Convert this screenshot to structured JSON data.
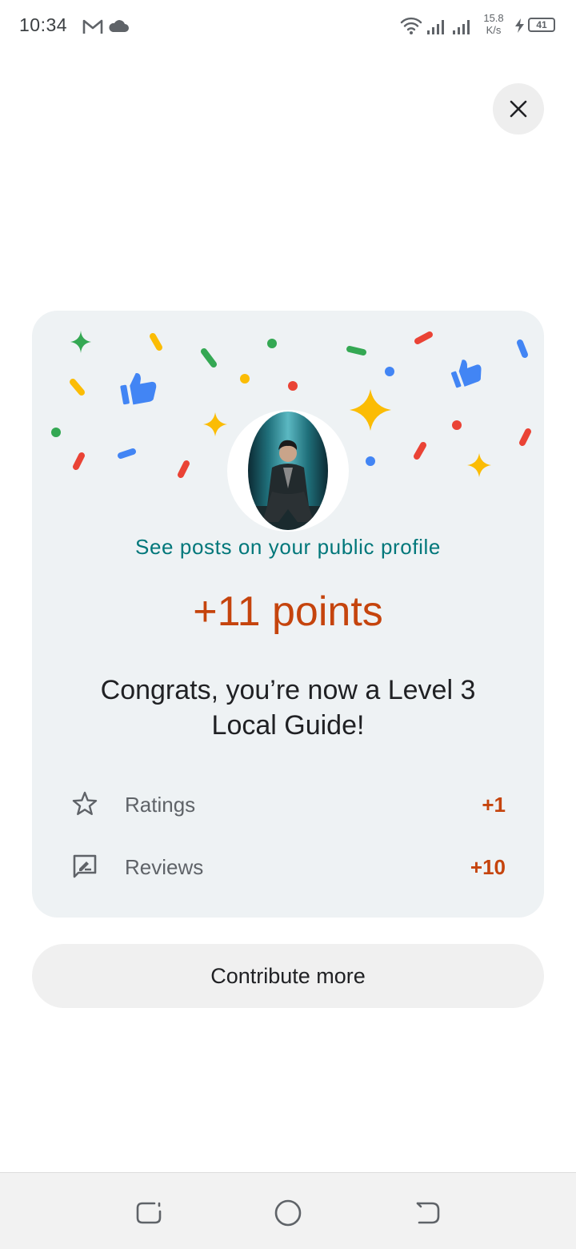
{
  "status_bar": {
    "time": "10:34",
    "net_speed_value": "15.8",
    "net_speed_unit": "K/s",
    "battery_level": "41",
    "icons": [
      "gmail-icon",
      "cloud-icon",
      "wifi-icon",
      "signal-icon",
      "signal-icon",
      "charging-icon",
      "battery-icon"
    ]
  },
  "dialog": {
    "close_icon": "close-icon",
    "profile_link": "See posts on your public profile",
    "points": "+11 points",
    "congrats": "Congrats, you’re now a Level 3 Local Guide!",
    "stats": [
      {
        "icon": "star-outline-icon",
        "label": "Ratings",
        "value": "+1"
      },
      {
        "icon": "review-icon",
        "label": "Reviews",
        "value": "+10"
      }
    ],
    "contribute_button": "Contribute more"
  },
  "nav_bar": {
    "icons": [
      "recents-icon",
      "home-icon",
      "back-icon"
    ]
  },
  "colors": {
    "accent_orange": "#c5440d",
    "link_teal": "#00777a",
    "card_bg": "#eef2f4",
    "confetti_green": "#34a853",
    "confetti_yellow": "#fbbc04",
    "confetti_red": "#ea4335",
    "confetti_blue": "#4285f4"
  }
}
